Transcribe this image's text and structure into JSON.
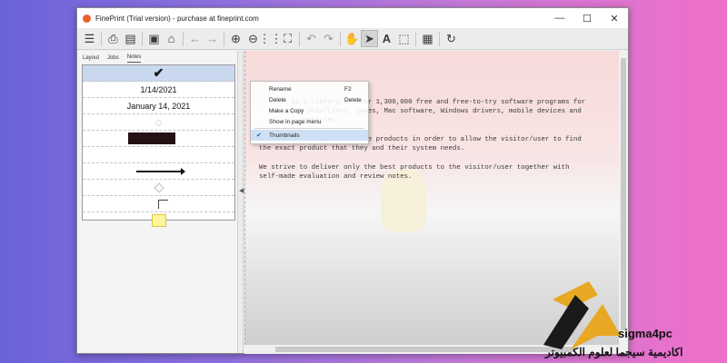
{
  "window": {
    "title": "FinePrint (Trial version) - purchase at fineprint.com"
  },
  "titlebar_buttons": {
    "minimize": "—",
    "maximize": "☐",
    "close": "✕"
  },
  "toolbar": {
    "buttons": [
      "menu-icon",
      "print-icon",
      "print-preview-icon",
      "save-icon",
      "open-folder-icon",
      "back-arrow-icon",
      "forward-arrow-icon",
      "zoom-in-icon",
      "zoom-out-icon",
      "grid-icon",
      "fit-page-icon",
      "undo-icon",
      "redo-icon",
      "hand-tool-icon",
      "pointer-icon",
      "text-tool-icon",
      "selection-tool-icon",
      "page-settings-icon",
      "refresh-icon"
    ]
  },
  "left_panel": {
    "tabs": [
      "Layout",
      "Jobs",
      "Notes"
    ],
    "active_tab": "Notes",
    "thumbnails": [
      "✔",
      "1/14/2021",
      "January 14, 2021",
      "",
      "",
      "",
      "",
      "",
      "",
      ""
    ]
  },
  "context_menu": {
    "items": [
      {
        "label": "Rename",
        "shortcut": "F2"
      },
      {
        "label": "Delete",
        "shortcut": "Delete"
      },
      {
        "label": "Make a Copy",
        "shortcut": ""
      },
      {
        "label": "Show in page menu",
        "shortcut": ""
      },
      {
        "label": "Thumbnails",
        "shortcut": "",
        "checked": true
      }
    ]
  },
  "document": {
    "paragraphs": [
      "        is a library of over 1,300,000 free and free-to-try software programs for\n        and Unix/Linux, games, Mac software, Windows drivers, mobile devices and\n           articles.",
      "        and categorize these products in order to allow the visitor/user to find\nthe exact product that they and their system needs.",
      "We strive to deliver only the best products to the visitor/user together with\nself-made evaluation and review notes."
    ]
  },
  "watermark": {
    "brand": "sigma4pc",
    "arabic": "اكاديمية سيجما لعلوم الكمبيوتر"
  }
}
